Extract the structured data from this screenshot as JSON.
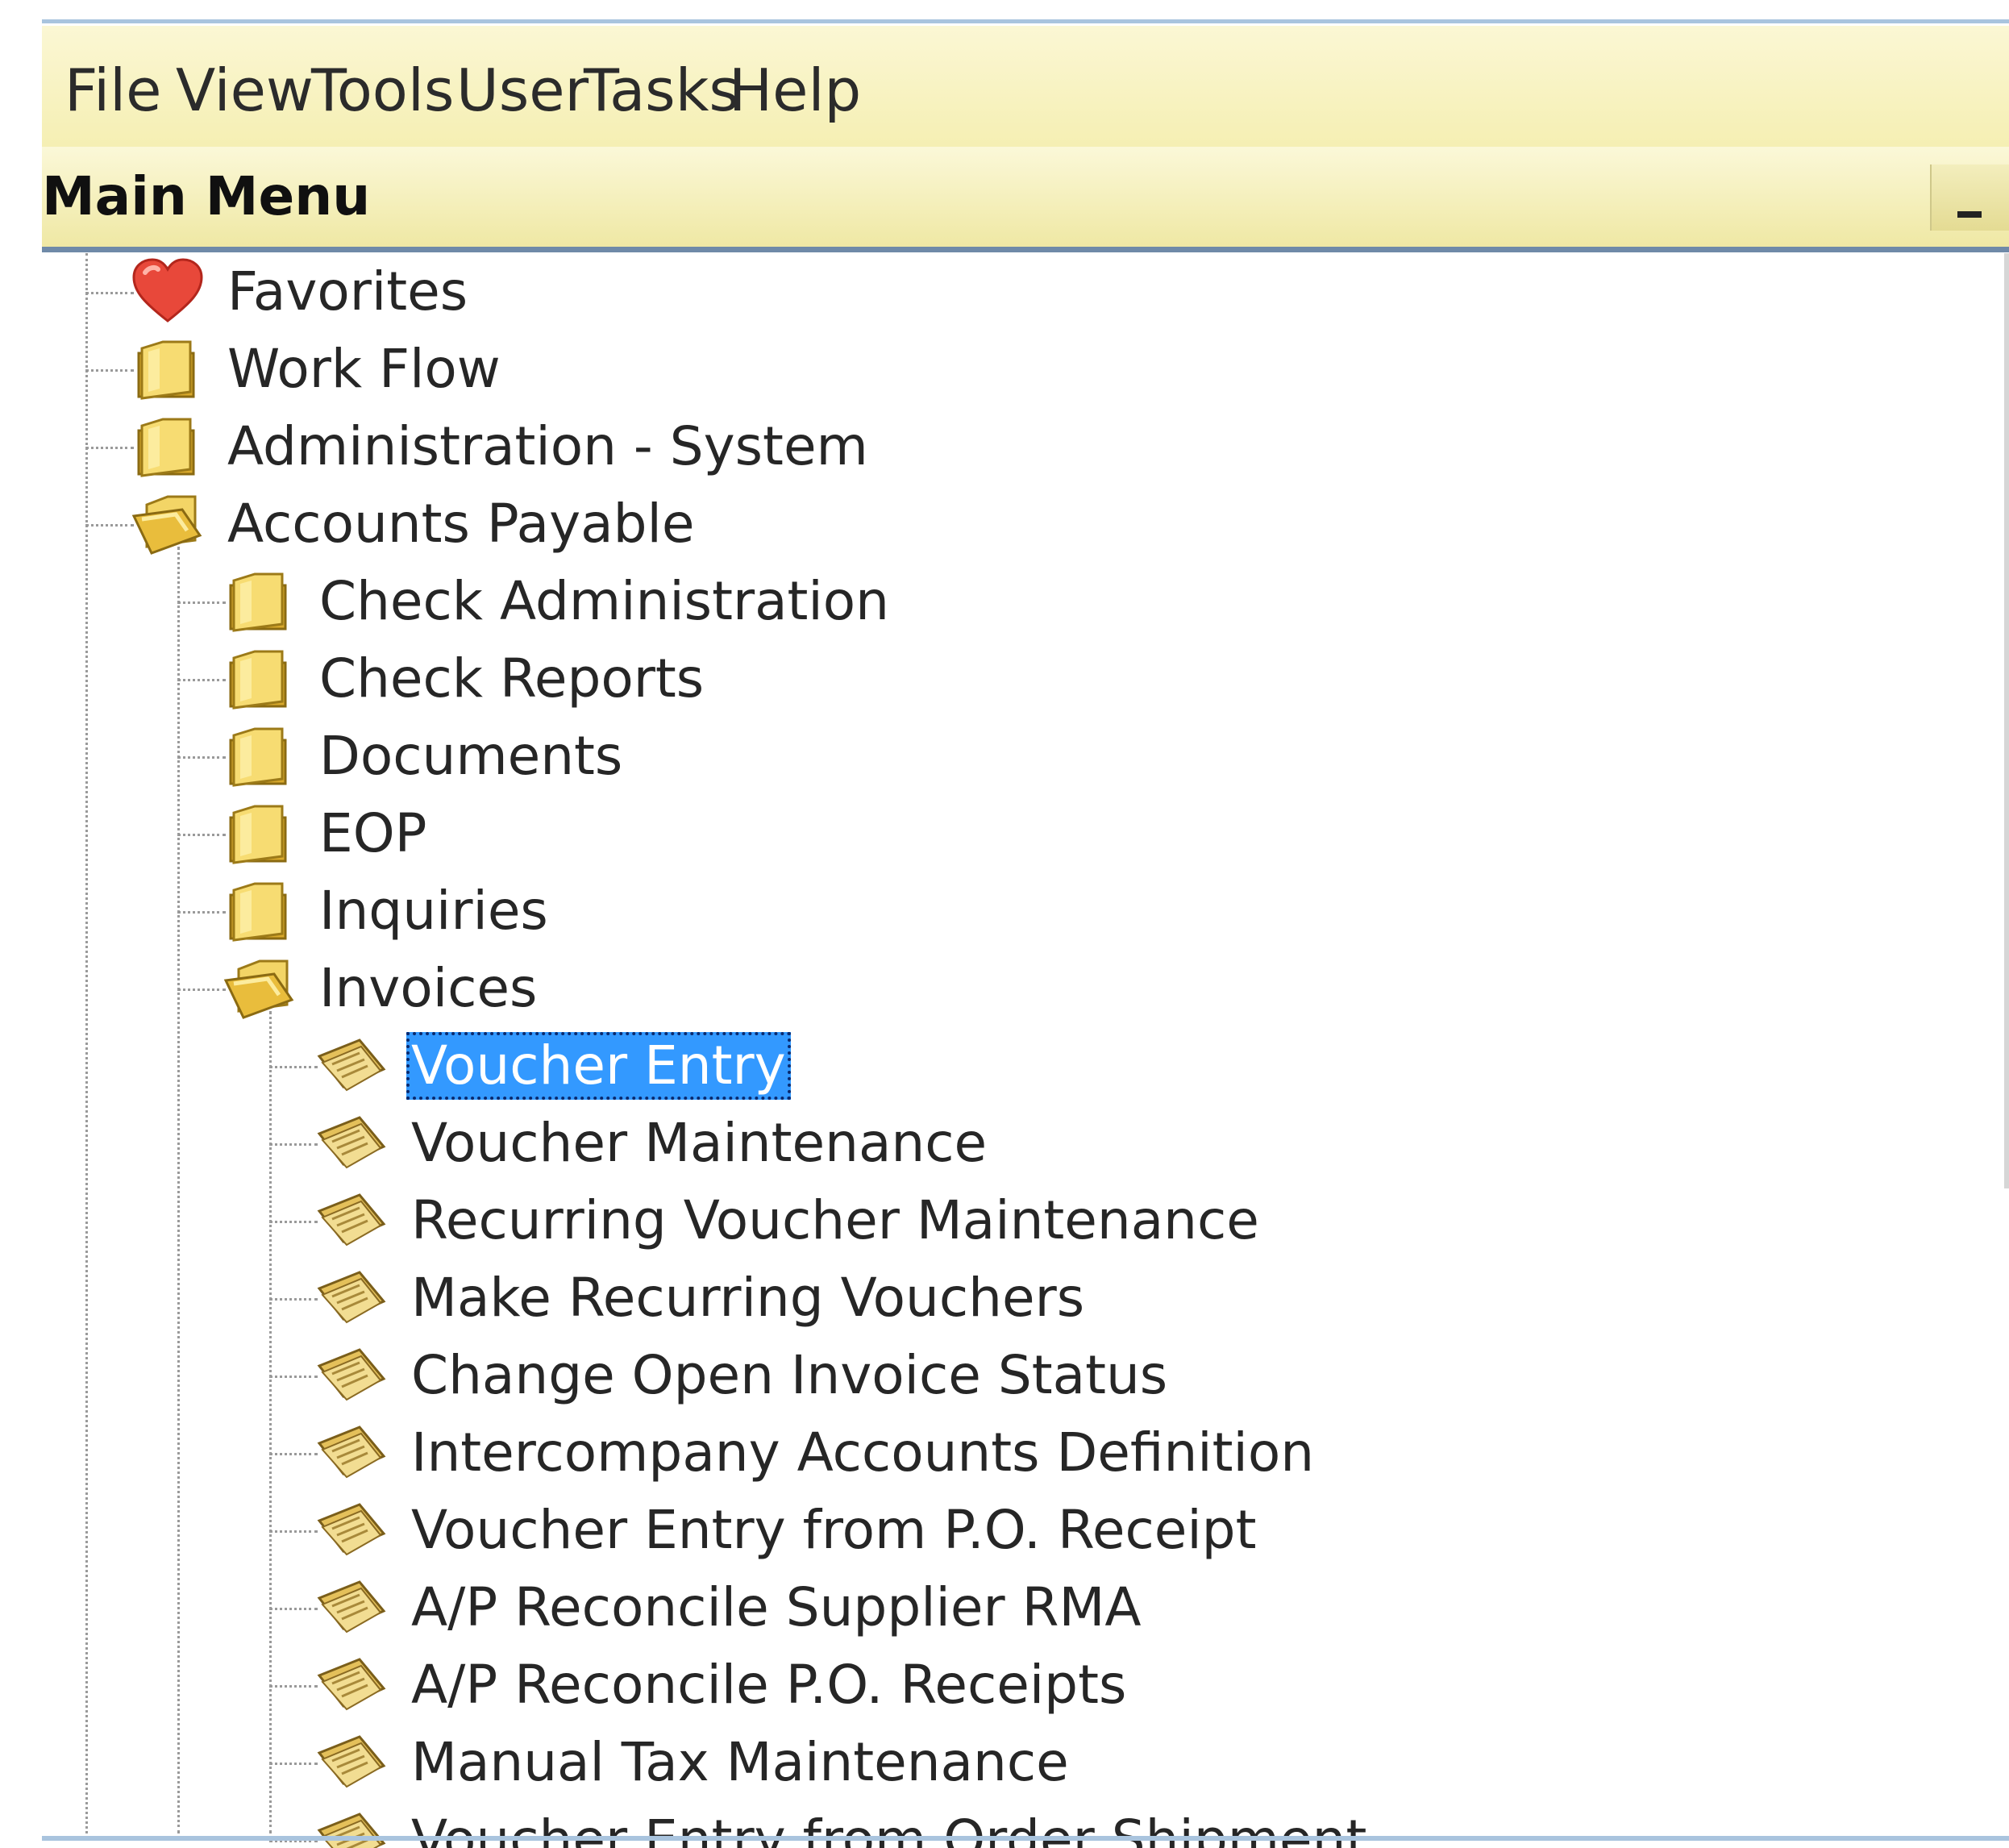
{
  "menubar": {
    "items": [
      "File",
      "View",
      "Tools",
      "User",
      "Tasks",
      "Help"
    ]
  },
  "panel": {
    "title": "Main Menu",
    "minimize": "minimize"
  },
  "tree": {
    "top_level": [
      {
        "label": "Favorites",
        "icon": "heart-icon"
      },
      {
        "label": "Work Flow",
        "icon": "folder-icon"
      },
      {
        "label": "Administration - System",
        "icon": "folder-icon"
      },
      {
        "label": "Accounts Payable",
        "icon": "folder-open-icon",
        "expanded": true
      }
    ],
    "accounts_payable": [
      {
        "label": "Check Administration",
        "icon": "folder-icon"
      },
      {
        "label": "Check Reports",
        "icon": "folder-icon"
      },
      {
        "label": "Documents",
        "icon": "folder-icon"
      },
      {
        "label": "EOP",
        "icon": "folder-icon"
      },
      {
        "label": "Inquiries",
        "icon": "folder-icon"
      },
      {
        "label": "Invoices",
        "icon": "folder-open-icon",
        "expanded": true
      }
    ],
    "invoices": [
      {
        "label": "Voucher Entry",
        "icon": "form-icon",
        "selected": true
      },
      {
        "label": "Voucher Maintenance",
        "icon": "form-icon"
      },
      {
        "label": "Recurring Voucher Maintenance",
        "icon": "form-icon"
      },
      {
        "label": "Make Recurring Vouchers",
        "icon": "form-icon"
      },
      {
        "label": "Change Open Invoice Status",
        "icon": "form-icon"
      },
      {
        "label": "Intercompany Accounts Definition",
        "icon": "form-icon"
      },
      {
        "label": "Voucher Entry from P.O. Receipt",
        "icon": "form-icon"
      },
      {
        "label": "A/P Reconcile Supplier RMA",
        "icon": "form-icon"
      },
      {
        "label": "A/P Reconcile P.O. Receipts",
        "icon": "form-icon"
      },
      {
        "label": "Manual Tax Maintenance",
        "icon": "form-icon"
      },
      {
        "label": "Voucher Entry from Order Shipment",
        "icon": "form-icon"
      }
    ]
  },
  "colors": {
    "menubar_bg": "#f7f1bd",
    "selection": "#3399ff",
    "folder": "#f2cf55",
    "heart": "#e8483a"
  }
}
